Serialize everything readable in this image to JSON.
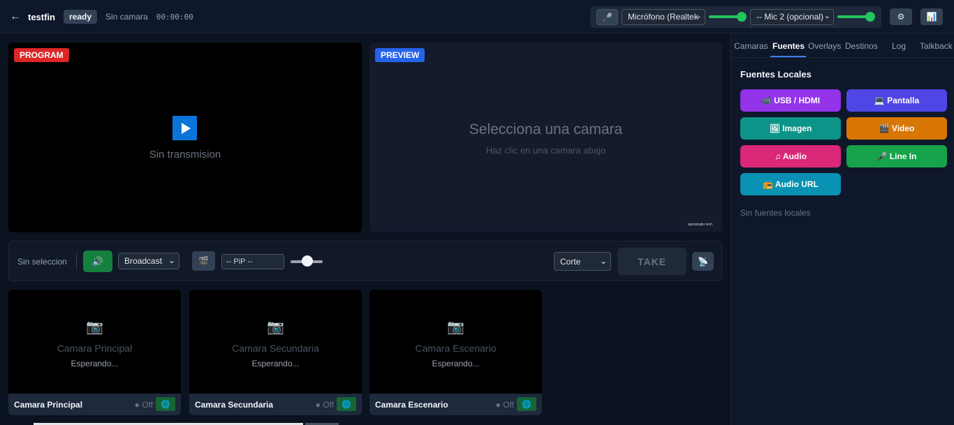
{
  "header": {
    "back_icon": "←",
    "title": "testfin",
    "status_badge": "ready",
    "camera_status": "Sin camara",
    "timer": "00:00:00",
    "mic_icon": "🎤",
    "mic1_select": "Micrófono (Realtek",
    "mic2_select": "-- Mic 2 (opcional)",
    "settings_icon": "⚙",
    "stats_icon": "📊"
  },
  "program": {
    "tag": "PROGRAM",
    "text": "Sin transmision"
  },
  "preview": {
    "tag": "PREVIEW",
    "title": "Selecciona una camara",
    "subtitle": "Haz clic en una camara abajo",
    "watermark": "openstudio tech"
  },
  "controls": {
    "selection_label": "Sin seleccion",
    "volume_icon": "🔊",
    "broadcast_select": "Broadcast",
    "clapper_icon": "🎬",
    "pip_select": "-- PiP --",
    "transition_select": "Corte",
    "take_label": "TAKE",
    "satellite_icon": "📡"
  },
  "cameras": [
    {
      "icon": "📷",
      "name": "Camara Principal",
      "waiting": "Esperando...",
      "footer_name": "Camara Principal",
      "status": "● Off",
      "globe_icon": "🌐"
    },
    {
      "icon": "📷",
      "name": "Camara Secundaria",
      "waiting": "Esperando...",
      "footer_name": "Camara Secundaria",
      "status": "● Off",
      "globe_icon": "🌐"
    },
    {
      "icon": "📷",
      "name": "Camara Escenario",
      "waiting": "Esperando...",
      "footer_name": "Camara Escenario",
      "status": "● Off",
      "globe_icon": "🌐"
    }
  ],
  "sidebar": {
    "tabs": [
      "Camaras",
      "Fuentes",
      "Overlays",
      "Destinos",
      "Log",
      "Talkback"
    ],
    "active_tab": "Fuentes",
    "title": "Fuentes Locales",
    "sources": [
      {
        "label": "📹 USB / HDMI",
        "color": "#9333ea"
      },
      {
        "label": "💻 Pantalla",
        "color": "#4f46e5"
      },
      {
        "label": "🖼 Imagen",
        "color": "#0d9488"
      },
      {
        "label": "🎬 Video",
        "color": "#d97706"
      },
      {
        "label": "♫ Audio",
        "color": "#db2777"
      },
      {
        "label": "🎤 Line In",
        "color": "#16a34a"
      },
      {
        "label": "📻 Audio URL",
        "color": "#0891b2"
      }
    ],
    "empty_text": "Sin fuentes locales"
  }
}
